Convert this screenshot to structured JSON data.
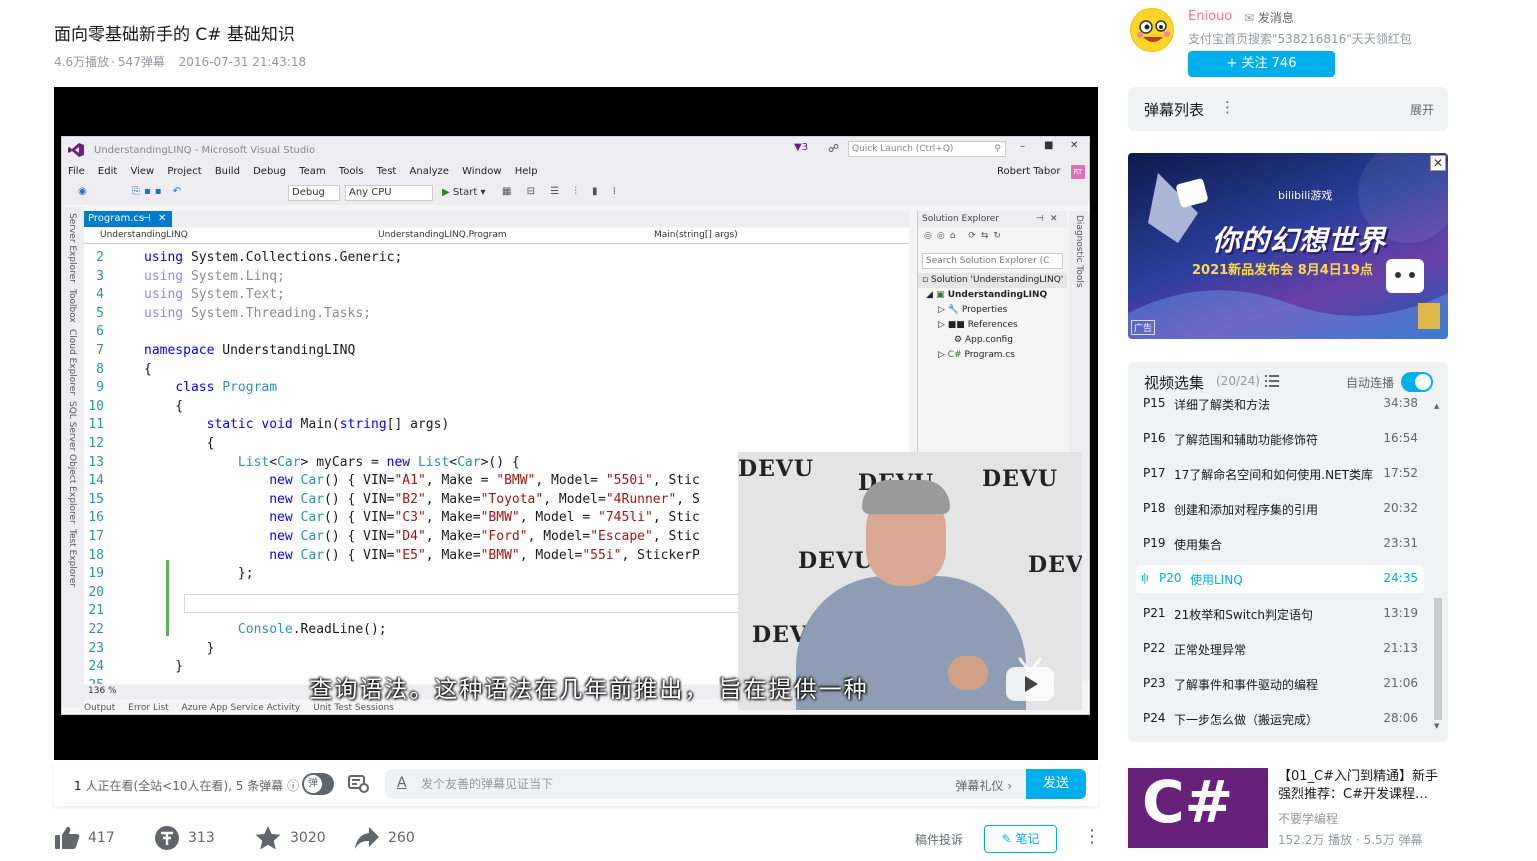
{
  "video": {
    "title": "面向零基础新手的 C# 基础知识",
    "plays": "4.6万播放",
    "separator": "·",
    "danmaku_count": "547弹幕",
    "date": "2016-07-31 21:43:18"
  },
  "vs": {
    "window_title": "UnderstandingLINQ - Microsoft Visual Studio",
    "quick_launch": "Quick Launch (Ctrl+Q)",
    "user": "Robert Tabor",
    "user_initials": "RT",
    "menu": [
      "File",
      "Edit",
      "View",
      "Project",
      "Build",
      "Debug",
      "Team",
      "Tools",
      "Test",
      "Analyze",
      "Window",
      "Help"
    ],
    "config": "Debug",
    "platform": "Any CPU",
    "start": "Start",
    "tab": "Program.cs",
    "nav_project": "UnderstandingLINQ",
    "nav_class": "UnderstandingLINQ.Program",
    "nav_member": "Main(string[] args)",
    "zoom": "136 %",
    "bottom_tabs": [
      "Output",
      "Error List",
      "Azure App Service Activity",
      "Unit Test Sessions"
    ],
    "side_tabs": [
      "Server Explorer",
      "Toolbox",
      "Cloud Explorer",
      "SQL Server Object Explorer",
      "Test Explorer"
    ],
    "diag_tab": "Diagnostic Tools",
    "solution": {
      "header": "Solution Explorer",
      "search": "Search Solution Explorer (C",
      "nodes": [
        "Solution 'UnderstandingLINQ'",
        "UnderstandingLINQ",
        "Properties",
        "References",
        "App.config",
        "Program.cs"
      ]
    },
    "code": [
      {
        "n": "2",
        "html": "<span class=\"kw\">using</span> System.Collections.Generic;"
      },
      {
        "n": "3",
        "html": "<span class=\"gy\"><span class=\"kw\">using</span> System.Linq;</span>"
      },
      {
        "n": "4",
        "html": "<span class=\"gy\"><span class=\"kw\">using</span> System.Text;</span>"
      },
      {
        "n": "5",
        "html": "<span class=\"gy\"><span class=\"kw\">using</span> System.Threading.Tasks;</span>"
      },
      {
        "n": "6",
        "html": ""
      },
      {
        "n": "7",
        "html": "<span class=\"kw\">namespace</span> UnderstandingLINQ"
      },
      {
        "n": "8",
        "html": "{"
      },
      {
        "n": "9",
        "html": "    <span class=\"kw\">class</span> <span class=\"ty\">Program</span>"
      },
      {
        "n": "10",
        "html": "    {"
      },
      {
        "n": "11",
        "html": "        <span class=\"kw\">static</span> <span class=\"kw\">void</span> Main(<span class=\"kw\">string</span>[] args)"
      },
      {
        "n": "12",
        "html": "        {"
      },
      {
        "n": "13",
        "html": "            <span class=\"ty\">List</span>&lt;<span class=\"ty\">Car</span>&gt; myCars = <span class=\"kw\">new</span> <span class=\"ty\">List</span>&lt;<span class=\"ty\">Car</span>&gt;() {"
      },
      {
        "n": "14",
        "html": "                <span class=\"kw\">new</span> <span class=\"ty\">Car</span>() { VIN=<span class=\"st\">\"A1\"</span>, Make = <span class=\"st\">\"BMW\"</span>, Model= <span class=\"st\">\"550i\"</span>, Stic"
      },
      {
        "n": "15",
        "html": "                <span class=\"kw\">new</span> <span class=\"ty\">Car</span>() { VIN=<span class=\"st\">\"B2\"</span>, Make=<span class=\"st\">\"Toyota\"</span>, Model=<span class=\"st\">\"4Runner\"</span>, S"
      },
      {
        "n": "16",
        "html": "                <span class=\"kw\">new</span> <span class=\"ty\">Car</span>() { VIN=<span class=\"st\">\"C3\"</span>, Make=<span class=\"st\">\"BMW\"</span>, Model = <span class=\"st\">\"745li\"</span>, Stic"
      },
      {
        "n": "17",
        "html": "                <span class=\"kw\">new</span> <span class=\"ty\">Car</span>() { VIN=<span class=\"st\">\"D4\"</span>, Make=<span class=\"st\">\"Ford\"</span>, Model=<span class=\"st\">\"Escape\"</span>, Stic"
      },
      {
        "n": "18",
        "html": "                <span class=\"kw\">new</span> <span class=\"ty\">Car</span>() { VIN=<span class=\"st\">\"E5\"</span>, Make=<span class=\"st\">\"BMW\"</span>, Model=<span class=\"st\">\"55i\"</span>, StickerP"
      },
      {
        "n": "19",
        "html": "            };"
      },
      {
        "n": "20",
        "html": ""
      },
      {
        "n": "21",
        "html": ""
      },
      {
        "n": "22",
        "html": "            <span class=\"ty\">Console</span>.ReadLine();"
      },
      {
        "n": "23",
        "html": "        }"
      },
      {
        "n": "24",
        "html": "    }"
      },
      {
        "n": "25",
        "html": ""
      }
    ]
  },
  "webcam": {
    "logo": "DEVU"
  },
  "subtitle": "查询语法。这种语法在几年前推出， 旨在提供一种",
  "controls": {
    "viewers_count": "1",
    "viewers_text": " 人正在看(全站<10人在看), 5 条弹幕",
    "toggle": "弹",
    "input_placeholder": "发个友善的弹幕见证当下",
    "etiquette": "弹幕礼仪 ›",
    "send": "发送"
  },
  "actions": {
    "like": "417",
    "coin": "313",
    "favorite": "3020",
    "share": "260",
    "report": "稿件投诉",
    "note": "笔记"
  },
  "uploader": {
    "name": "Eniouo",
    "message": "发消息",
    "sign": "支付宝首页搜索\"538216816\"天天领红包",
    "follow": "+  关注 746"
  },
  "danmaku_list": {
    "title": "弹幕列表",
    "expand": "展开"
  },
  "ad": {
    "brand": "bilibili游戏",
    "headline": "你的幻想世界",
    "sub": "2021新品发布会 8月4日19点",
    "tag": "广告"
  },
  "playlist": {
    "title": "视频选集",
    "count": "(20/24)",
    "autoplay": "自动连播",
    "items": [
      {
        "p": "P15",
        "t": "详细了解类和方法",
        "d": "34:38"
      },
      {
        "p": "P16",
        "t": "了解范围和辅助功能修饰符",
        "d": "16:54"
      },
      {
        "p": "P17",
        "t": "17了解命名空间和如何使用.NET类库",
        "d": "17:52"
      },
      {
        "p": "P18",
        "t": "创建和添加对程序集的引用",
        "d": "20:32"
      },
      {
        "p": "P19",
        "t": "使用集合",
        "d": "23:31"
      },
      {
        "p": "P20",
        "t": "使用LINQ",
        "d": "24:35",
        "active": true
      },
      {
        "p": "P21",
        "t": "21枚举和Switch判定语句",
        "d": "13:19"
      },
      {
        "p": "P22",
        "t": "正常处理异常",
        "d": "21:13"
      },
      {
        "p": "P23",
        "t": "了解事件和事件驱动的编程",
        "d": "21:06"
      },
      {
        "p": "P24",
        "t": "下一步怎么做（搬运完成）",
        "d": "28:06"
      }
    ]
  },
  "recommend": {
    "thumb_text": "C#",
    "title": "【01_C#入门到精通】新手强烈推荐：C#开发课程…",
    "uploader": "不要学编程",
    "stats": "152.2万 播放 · 5.5万 弹幕"
  },
  "colors": {
    "accent": "#00aeec",
    "uploader": "#fb7299",
    "vs_blue": "#007acc"
  }
}
